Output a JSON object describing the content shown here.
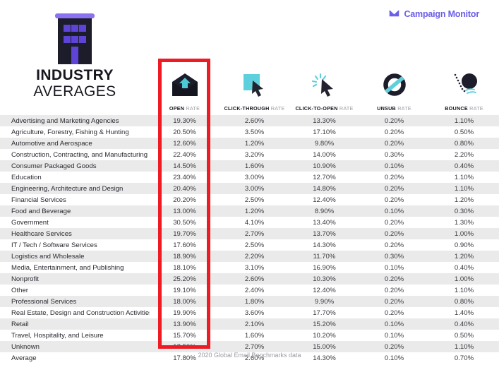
{
  "brand": {
    "name": "Campaign Monitor",
    "mark_icon": "envelope-logo-icon",
    "color": "#6a5de8"
  },
  "title": {
    "line1": "INDUSTRY",
    "line2": "AVERAGES",
    "icon": "office-building-icon"
  },
  "highlight": {
    "target_column": "OPEN RATE",
    "color": "#ee1b24"
  },
  "columns": [
    {
      "key": "industry",
      "label": "",
      "label_bold": "",
      "label_light": "",
      "icon": ""
    },
    {
      "key": "open_rate",
      "label": "OPEN RATE",
      "label_bold": "OPEN",
      "label_light": "RATE",
      "icon": "open-envelope-icon"
    },
    {
      "key": "click_through_rate",
      "label": "CLICK-THROUGH RATE",
      "label_bold": "CLICK-THROUGH",
      "label_light": "RATE",
      "icon": "cursor-on-square-icon"
    },
    {
      "key": "click_to_open_rate",
      "label": "CLICK-TO-OPEN RATE",
      "label_bold": "CLICK-TO-OPEN",
      "label_light": "RATE",
      "icon": "cursor-click-burst-icon"
    },
    {
      "key": "unsub_rate",
      "label": "UNSUB RATE",
      "label_bold": "UNSUB",
      "label_light": "RATE",
      "icon": "no-entry-circle-icon"
    },
    {
      "key": "bounce_rate",
      "label": "BOUNCE RATE",
      "label_bold": "BOUNCE",
      "label_light": "RATE",
      "icon": "bouncing-ball-icon"
    }
  ],
  "rows": [
    {
      "industry": "Advertising and Marketing Agencies",
      "open_rate": "19.30%",
      "click_through_rate": "2.60%",
      "click_to_open_rate": "13.30%",
      "unsub_rate": "0.20%",
      "bounce_rate": "1.10%"
    },
    {
      "industry": "Agriculture, Forestry, Fishing & Hunting",
      "open_rate": "20.50%",
      "click_through_rate": "3.50%",
      "click_to_open_rate": "17.10%",
      "unsub_rate": "0.20%",
      "bounce_rate": "0.50%"
    },
    {
      "industry": "Automotive and Aerospace",
      "open_rate": "12.60%",
      "click_through_rate": "1.20%",
      "click_to_open_rate": "9.80%",
      "unsub_rate": "0.20%",
      "bounce_rate": "0.80%"
    },
    {
      "industry": "Construction, Contracting, and Manufacturing",
      "open_rate": "22.40%",
      "click_through_rate": "3.20%",
      "click_to_open_rate": "14.00%",
      "unsub_rate": "0.30%",
      "bounce_rate": "2.20%"
    },
    {
      "industry": "Consumer Packaged Goods",
      "open_rate": "14.50%",
      "click_through_rate": "1.60%",
      "click_to_open_rate": "10.90%",
      "unsub_rate": "0.10%",
      "bounce_rate": "0.40%"
    },
    {
      "industry": "Education",
      "open_rate": "23.40%",
      "click_through_rate": "3.00%",
      "click_to_open_rate": "12.70%",
      "unsub_rate": "0.20%",
      "bounce_rate": "1.10%"
    },
    {
      "industry": "Engineering, Architecture and Design",
      "open_rate": "20.40%",
      "click_through_rate": "3.00%",
      "click_to_open_rate": "14.80%",
      "unsub_rate": "0.20%",
      "bounce_rate": "1.10%"
    },
    {
      "industry": "Financial Services",
      "open_rate": "20.20%",
      "click_through_rate": "2.50%",
      "click_to_open_rate": "12.40%",
      "unsub_rate": "0.20%",
      "bounce_rate": "1.20%"
    },
    {
      "industry": "Food and Beverage",
      "open_rate": "13.00%",
      "click_through_rate": "1.20%",
      "click_to_open_rate": "8.90%",
      "unsub_rate": "0.10%",
      "bounce_rate": "0.30%"
    },
    {
      "industry": "Government",
      "open_rate": "30.50%",
      "click_through_rate": "4.10%",
      "click_to_open_rate": "13.40%",
      "unsub_rate": "0.20%",
      "bounce_rate": "1.30%"
    },
    {
      "industry": "Healthcare Services",
      "open_rate": "19.70%",
      "click_through_rate": "2.70%",
      "click_to_open_rate": "13.70%",
      "unsub_rate": "0.20%",
      "bounce_rate": "1.00%"
    },
    {
      "industry": "IT / Tech / Software Services",
      "open_rate": "17.60%",
      "click_through_rate": "2.50%",
      "click_to_open_rate": "14.30%",
      "unsub_rate": "0.20%",
      "bounce_rate": "0.90%"
    },
    {
      "industry": "Logistics and Wholesale",
      "open_rate": "18.90%",
      "click_through_rate": "2.20%",
      "click_to_open_rate": "11.70%",
      "unsub_rate": "0.30%",
      "bounce_rate": "1.20%"
    },
    {
      "industry": "Media, Entertainment, and Publishing",
      "open_rate": "18.10%",
      "click_through_rate": "3.10%",
      "click_to_open_rate": "16.90%",
      "unsub_rate": "0.10%",
      "bounce_rate": "0.40%"
    },
    {
      "industry": "Nonprofit",
      "open_rate": "25.20%",
      "click_through_rate": "2.60%",
      "click_to_open_rate": "10.30%",
      "unsub_rate": "0.20%",
      "bounce_rate": "1.00%"
    },
    {
      "industry": "Other",
      "open_rate": "19.10%",
      "click_through_rate": "2.40%",
      "click_to_open_rate": "12.40%",
      "unsub_rate": "0.20%",
      "bounce_rate": "1.10%"
    },
    {
      "industry": "Professional Services",
      "open_rate": "18.00%",
      "click_through_rate": "1.80%",
      "click_to_open_rate": "9.90%",
      "unsub_rate": "0.20%",
      "bounce_rate": "0.80%"
    },
    {
      "industry": "Real Estate, Design and Construction Activities",
      "open_rate": "19.90%",
      "click_through_rate": "3.60%",
      "click_to_open_rate": "17.70%",
      "unsub_rate": "0.20%",
      "bounce_rate": "1.40%"
    },
    {
      "industry": "Retail",
      "open_rate": "13.90%",
      "click_through_rate": "2.10%",
      "click_to_open_rate": "15.20%",
      "unsub_rate": "0.10%",
      "bounce_rate": "0.40%"
    },
    {
      "industry": "Travel, Hospitality, and Leisure",
      "open_rate": "15.70%",
      "click_through_rate": "1.60%",
      "click_to_open_rate": "10.20%",
      "unsub_rate": "0.10%",
      "bounce_rate": "0.50%"
    },
    {
      "industry": "Unknown",
      "open_rate": "17.50%",
      "click_through_rate": "2.70%",
      "click_to_open_rate": "15.00%",
      "unsub_rate": "0.20%",
      "bounce_rate": "1.10%"
    },
    {
      "industry": "Average",
      "open_rate": "17.80%",
      "click_through_rate": "2.60%",
      "click_to_open_rate": "14.30%",
      "unsub_rate": "0.10%",
      "bounce_rate": "0.70%"
    }
  ],
  "footer": {
    "source": "2020 Global Email Benchmarks data"
  },
  "chart_data": {
    "type": "table",
    "title": "INDUSTRY AVERAGES",
    "subtitle": "2020 Global Email Benchmarks data",
    "columns": [
      "Industry",
      "OPEN RATE",
      "CLICK-THROUGH RATE",
      "CLICK-TO-OPEN RATE",
      "UNSUB RATE",
      "BOUNCE RATE"
    ],
    "units": "percent",
    "highlighted_column": "OPEN RATE",
    "categories": [
      "Advertising and Marketing Agencies",
      "Agriculture, Forestry, Fishing & Hunting",
      "Automotive and Aerospace",
      "Construction, Contracting, and Manufacturing",
      "Consumer Packaged Goods",
      "Education",
      "Engineering, Architecture and Design",
      "Financial Services",
      "Food and Beverage",
      "Government",
      "Healthcare Services",
      "IT / Tech / Software Services",
      "Logistics and Wholesale",
      "Media, Entertainment, and Publishing",
      "Nonprofit",
      "Other",
      "Professional Services",
      "Real Estate, Design and Construction Activities",
      "Retail",
      "Travel, Hospitality, and Leisure",
      "Unknown",
      "Average"
    ],
    "series": [
      {
        "name": "OPEN RATE",
        "values": [
          19.3,
          20.5,
          12.6,
          22.4,
          14.5,
          23.4,
          20.4,
          20.2,
          13.0,
          30.5,
          19.7,
          17.6,
          18.9,
          18.1,
          25.2,
          19.1,
          18.0,
          19.9,
          13.9,
          15.7,
          17.5,
          17.8
        ]
      },
      {
        "name": "CLICK-THROUGH RATE",
        "values": [
          2.6,
          3.5,
          1.2,
          3.2,
          1.6,
          3.0,
          3.0,
          2.5,
          1.2,
          4.1,
          2.7,
          2.5,
          2.2,
          3.1,
          2.6,
          2.4,
          1.8,
          3.6,
          2.1,
          1.6,
          2.7,
          2.6
        ]
      },
      {
        "name": "CLICK-TO-OPEN RATE",
        "values": [
          13.3,
          17.1,
          9.8,
          14.0,
          10.9,
          12.7,
          14.8,
          12.4,
          8.9,
          13.4,
          13.7,
          14.3,
          11.7,
          16.9,
          10.3,
          12.4,
          9.9,
          17.7,
          15.2,
          10.2,
          15.0,
          14.3
        ]
      },
      {
        "name": "UNSUB RATE",
        "values": [
          0.2,
          0.2,
          0.2,
          0.3,
          0.1,
          0.2,
          0.2,
          0.2,
          0.1,
          0.2,
          0.2,
          0.2,
          0.3,
          0.1,
          0.2,
          0.2,
          0.2,
          0.2,
          0.1,
          0.1,
          0.2,
          0.1
        ]
      },
      {
        "name": "BOUNCE RATE",
        "values": [
          1.1,
          0.5,
          0.8,
          2.2,
          0.4,
          1.1,
          1.1,
          1.2,
          0.3,
          1.3,
          1.0,
          0.9,
          1.2,
          0.4,
          1.0,
          1.1,
          0.8,
          1.4,
          0.4,
          0.5,
          1.1,
          0.7
        ]
      }
    ]
  }
}
